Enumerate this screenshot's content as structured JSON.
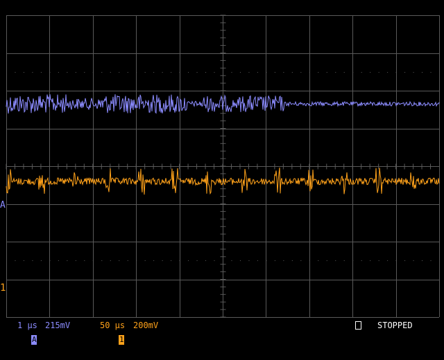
{
  "colors": {
    "background": "#000000",
    "grid": "#5a5a5a",
    "channel_a": "#8c8cff",
    "channel_1": "#ffa21a",
    "status_text": "#ffffff"
  },
  "markers": {
    "channel_a_label": "A",
    "channel_1_label": "1"
  },
  "status": {
    "channel_a": {
      "label": "A",
      "timebase": "1 µs",
      "volts_per_div": "215mV"
    },
    "channel_1": {
      "label": "1",
      "timebase": "50 µs",
      "volts_per_div": "200mV"
    },
    "run_state": "STOPPED"
  }
}
